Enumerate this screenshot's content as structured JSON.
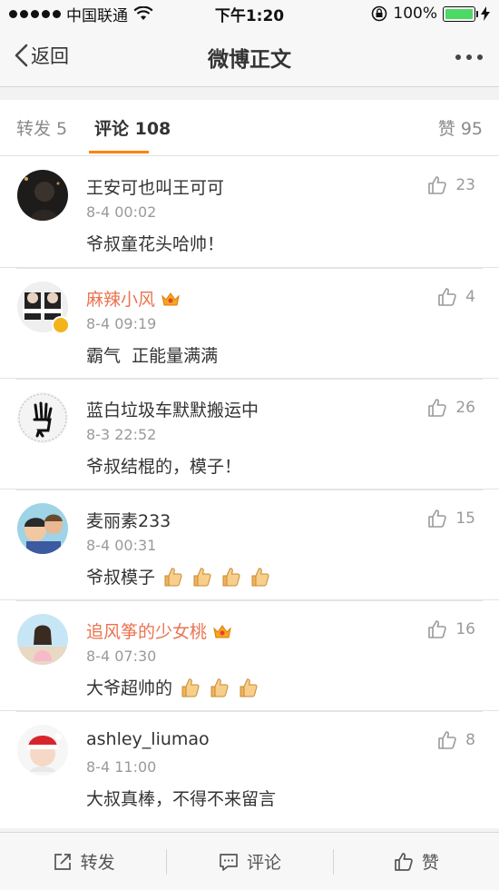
{
  "status_bar": {
    "carrier": "中国联通",
    "time": "下午1:20",
    "battery": "100%",
    "battery_level": 1.0,
    "signal_icon": "signal-dots-icon",
    "wifi_icon": "wifi-icon",
    "lock_icon": "orientation-lock-icon",
    "charging_icon": "charging-bolt-icon"
  },
  "nav": {
    "back_label": "返回",
    "title": "微博正文",
    "more_icon": "more-dots-icon"
  },
  "tabs": {
    "repost": "转发 5",
    "comments": "评论 108",
    "likes": "赞 95",
    "active": "comments",
    "accent": "#ff8200"
  },
  "comments": [
    {
      "username": "王安可也叫王可可",
      "vip": false,
      "verified": false,
      "time": "8-4 00:02",
      "text": "爷叔童花头哈帅！",
      "thumbs": 0,
      "likes": "23"
    },
    {
      "username": "麻辣小风",
      "vip": true,
      "verified": true,
      "time": "8-4 09:19",
      "text": "霸气  正能量满满",
      "thumbs": 0,
      "likes": "4"
    },
    {
      "username": "蓝白垃圾车默默搬运中",
      "vip": false,
      "verified": false,
      "time": "8-3 22:52",
      "text": "爷叔结棍的，模子！",
      "thumbs": 0,
      "likes": "26"
    },
    {
      "username": "麦丽素233",
      "vip": false,
      "verified": false,
      "time": "8-4 00:31",
      "text": "爷叔模子",
      "thumbs": 4,
      "likes": "15"
    },
    {
      "username": "追风筝的少女桃",
      "vip": true,
      "verified": false,
      "time": "8-4 07:30",
      "text": "大爷超帅的",
      "thumbs": 3,
      "likes": "16"
    },
    {
      "username": "ashley_liumao",
      "vip": false,
      "verified": false,
      "time": "8-4 11:00",
      "text": "大叔真棒，不得不来留言",
      "thumbs": 0,
      "likes": "8"
    }
  ],
  "colors": {
    "vip_name": "#eb7350",
    "verified_badge": "#f4b21b",
    "battery_fill": "#4cd964"
  },
  "toolbar": {
    "repost": "转发",
    "comment": "评论",
    "like": "赞"
  }
}
